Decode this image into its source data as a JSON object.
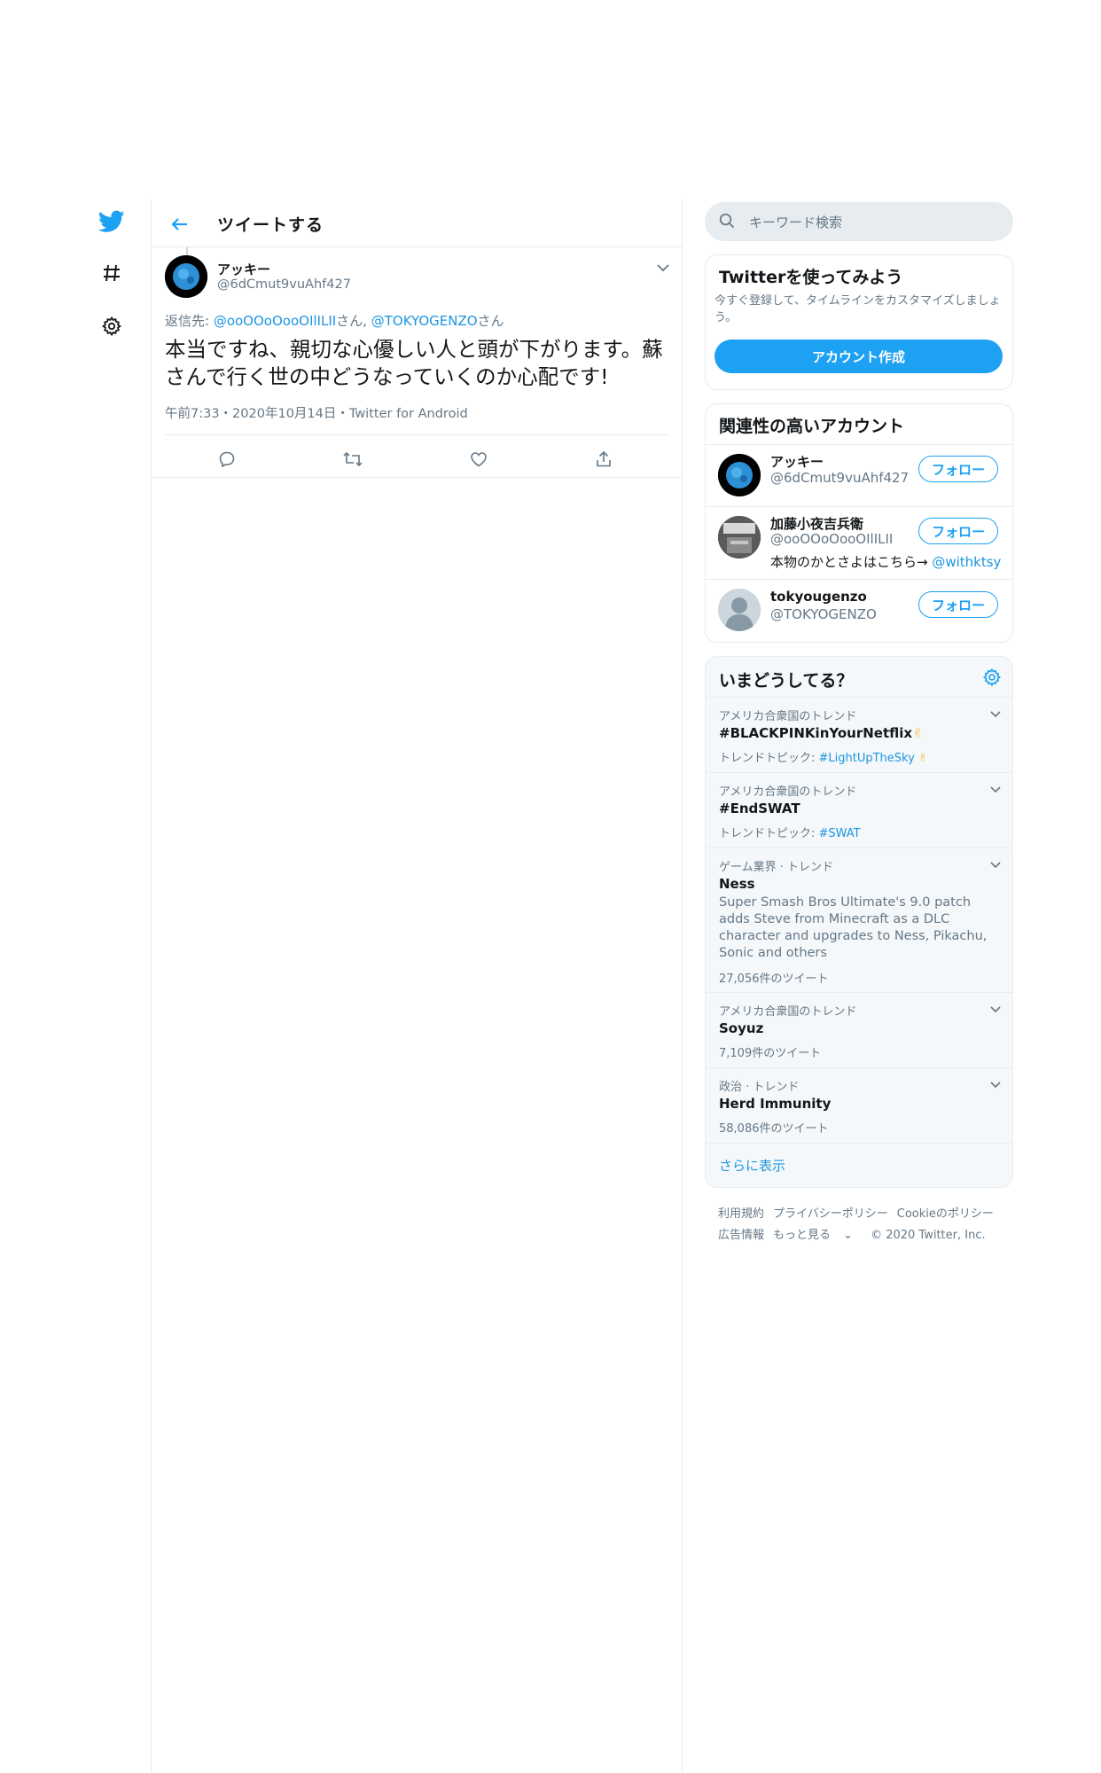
{
  "colors": {
    "accent": "#1da1f2",
    "link": "#1b95e0",
    "text": "#14171a",
    "muted": "#657786",
    "border": "#e6ecf0"
  },
  "nav": {
    "icons": [
      "twitter-logo-icon",
      "hashtag-icon",
      "gear-icon"
    ]
  },
  "header": {
    "title": "ツイートする"
  },
  "tweet": {
    "author_name": "アッキー",
    "author_handle": "@6dCmut9vuAhf427",
    "reply_prefix": "返信先: ",
    "reply_user1": "@ooOOoOooOIlILII",
    "reply_san1": "さん, ",
    "reply_user2": "@TOKYOGENZO",
    "reply_san2": "さん",
    "text": "本当ですね、親切な心優しい人と頭が下がります。蘇さんで行く世の中どうなっていくのか心配です!",
    "meta": "午前7:33・2020年10月14日・Twitter for Android",
    "actions": [
      "reply-icon",
      "retweet-icon",
      "like-icon",
      "share-icon"
    ]
  },
  "search": {
    "placeholder": "キーワード検索"
  },
  "signup": {
    "title": "Twitterを使ってみよう",
    "subtitle": "今すぐ登録して、タイムラインをカスタマイズしましょう。",
    "button": "アカウント作成"
  },
  "related": {
    "title": "関連性の高いアカウント",
    "follow_label": "フォロー",
    "accounts": [
      {
        "name": "アッキー",
        "handle": "@6dCmut9vuAhf427",
        "bio": ""
      },
      {
        "name": "加藤小夜吉兵衛",
        "handle": "@ooOOoOooOIlILII",
        "bio": "本物のかとさよはこちら→ ",
        "bio_link": "@withktsy"
      },
      {
        "name": "tokyougenzo",
        "handle": "@TOKYOGENZO",
        "bio": ""
      }
    ]
  },
  "trends": {
    "title": "いまどうしてる？",
    "items": [
      {
        "context": "アメリカ合衆国のトレンド",
        "name": "#BLACKPINKinYourNetflix",
        "topic_label": "トレンドトピック: ",
        "topic": "#LightUpTheSky"
      },
      {
        "context": "アメリカ合衆国のトレンド",
        "name": "#EndSWAT",
        "topic_label": "トレンドトピック: ",
        "topic": "#SWAT"
      },
      {
        "context": "ゲーム業界 · トレンド",
        "name": "Ness",
        "description": "Super Smash Bros Ultimate's 9.0 patch adds Steve from Minecraft as a DLC character and upgrades to Ness, Pikachu, Sonic and others",
        "count": "27,056件のツイート"
      },
      {
        "context": "アメリカ合衆国のトレンド",
        "name": "Soyuz",
        "count": "7,109件のツイート"
      },
      {
        "context": "政治 · トレンド",
        "name": "Herd Immunity",
        "count": "58,086件のツイート"
      }
    ],
    "show_more": "さらに表示"
  },
  "footer": {
    "links_row1": [
      "利用規約",
      "プライバシーポリシー",
      "Cookieのポリシー"
    ],
    "links_row2": [
      "広告情報",
      "もっと見る"
    ],
    "copyright": "© 2020 Twitter, Inc."
  }
}
